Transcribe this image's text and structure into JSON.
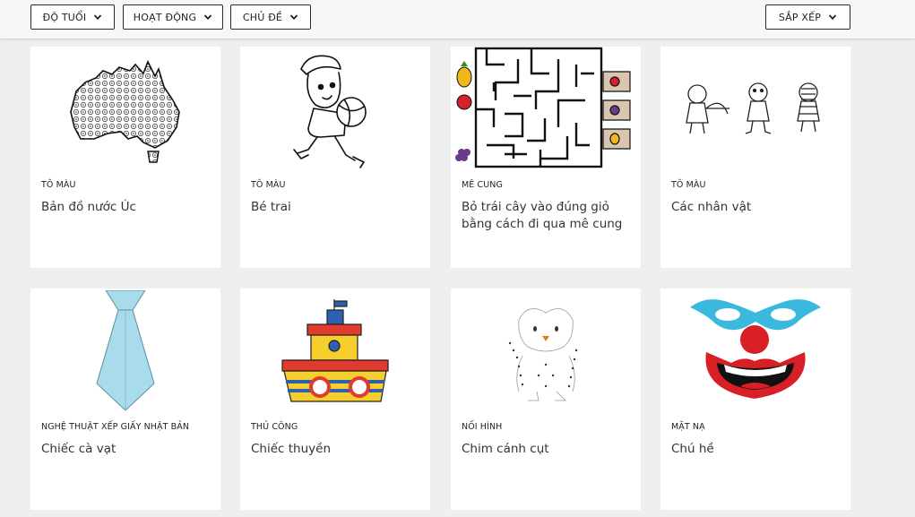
{
  "filters": {
    "age_label": "ĐỘ TUỔI",
    "activity_label": "HOẠT ĐỘNG",
    "topic_label": "CHỦ ĐỀ",
    "sort_label": "SẮP XẾP"
  },
  "cards": [
    {
      "category": "TÔ MÀU",
      "title": "Bản đồ nước Úc",
      "image": "australia-map-coloring"
    },
    {
      "category": "TÔ MÀU",
      "title": "Bé trai",
      "image": "boy-with-ball-coloring"
    },
    {
      "category": "MÊ CUNG",
      "title": "Bỏ trái cây vào đúng giỏ bằng cách đi qua mê cung",
      "image": "fruit-maze"
    },
    {
      "category": "TÔ MÀU",
      "title": "Các nhân vật",
      "image": "characters-coloring"
    },
    {
      "category": "NGHỆ THUẬT XẾP GIẤY NHẬT BẢN",
      "title": "Chiếc cà vạt",
      "image": "origami-tie"
    },
    {
      "category": "THỦ CÔNG",
      "title": "Chiếc thuyền",
      "image": "paper-boat-craft"
    },
    {
      "category": "NỐI HÌNH",
      "title": "Chim cánh cụt",
      "image": "penguin-dot-to-dot"
    },
    {
      "category": "MẶT NẠ",
      "title": "Chú hề",
      "image": "clown-mask"
    }
  ],
  "colors": {
    "background": "#efefef",
    "card": "#ffffff",
    "tie": "#a9dcea",
    "mask_blue": "#3bb8de",
    "mask_red": "#d91f26"
  }
}
